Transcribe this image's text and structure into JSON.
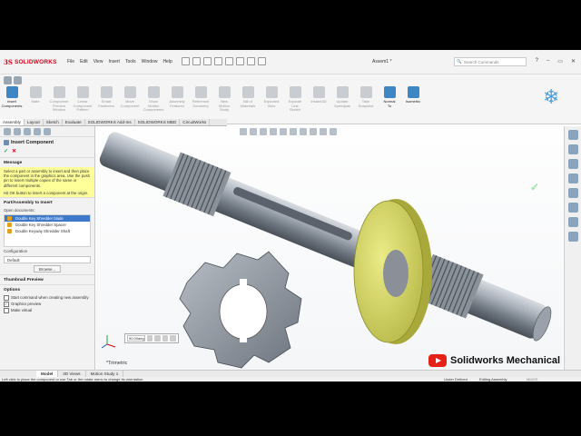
{
  "app": {
    "brand": "SOLIDWORKS",
    "document": "Assem1 *"
  },
  "menu": [
    "File",
    "Edit",
    "View",
    "Insert",
    "Tools",
    "Window",
    "Help"
  ],
  "search": {
    "placeholder": "Search Commands"
  },
  "ribbon": {
    "tools": [
      {
        "label": "Insert\nComponents",
        "active": true,
        "icon": "insert-components-icon"
      },
      {
        "label": "Mate",
        "active": false,
        "icon": "mate-icon"
      },
      {
        "label": "Component\nPreview\nWindow",
        "active": false,
        "icon": "component-preview-icon"
      },
      {
        "label": "Linear\nComponent\nPattern",
        "active": false,
        "icon": "linear-pattern-icon"
      },
      {
        "label": "Smart\nFasteners",
        "active": false,
        "icon": "smart-fasteners-icon"
      },
      {
        "label": "Move\nComponent",
        "active": false,
        "icon": "move-component-icon"
      },
      {
        "label": "Show\nHidden\nComponents",
        "active": false,
        "icon": "show-hidden-icon"
      },
      {
        "label": "Assembly\nFeatures",
        "active": false,
        "icon": "assembly-features-icon"
      },
      {
        "label": "Reference\nGeometry",
        "active": false,
        "icon": "reference-geometry-icon"
      },
      {
        "label": "New\nMotion\nStudy",
        "active": false,
        "icon": "motion-study-icon"
      },
      {
        "label": "Bill of\nMaterials",
        "active": false,
        "icon": "bom-icon"
      },
      {
        "label": "Exploded\nView",
        "active": false,
        "icon": "exploded-view-icon"
      },
      {
        "label": "Explode\nLine\nSketch",
        "active": false,
        "icon": "explode-line-icon"
      },
      {
        "label": "Instant3D",
        "active": false,
        "icon": "instant3d-icon"
      },
      {
        "label": "Update\nSpeedpak",
        "active": false,
        "icon": "speedpak-icon"
      },
      {
        "label": "Take\nSnapshot",
        "active": false,
        "icon": "snapshot-icon"
      },
      {
        "label": "Normal\nTo",
        "active": true,
        "icon": "normal-to-icon"
      },
      {
        "label": "Isometric",
        "active": true,
        "icon": "isometric-icon"
      }
    ]
  },
  "tabs": [
    "Assembly",
    "Layout",
    "Sketch",
    "Evaluate",
    "SOLIDWORKS Add-Ins",
    "SOLIDWORKS MBD",
    "CircuitWorks"
  ],
  "panel": {
    "title": "Insert Component",
    "message_header": "Message",
    "message": "Select a part or assembly to insert and then place the component in the graphics area. Use the push pin to insert multiple copies of the same or different components.",
    "message2": "Hit OK button to insert a component at the origin.",
    "part_header": "Part/Assembly to Insert",
    "open_docs_label": "Open documents:",
    "documents": [
      "Double Key Shredder blade",
      "Double Key Shredder Spacer",
      "Double Keyway Shredder Shaft"
    ],
    "config_label": "Configuration",
    "config_value": "Default",
    "browse": "Browse...",
    "thumb_header": "Thumbnail Preview",
    "options_header": "Options",
    "options": [
      {
        "label": "Start command when creating new assembly",
        "checked": false
      },
      {
        "label": "Graphics preview",
        "checked": true
      },
      {
        "label": "Make virtual",
        "checked": false
      }
    ]
  },
  "viewport": {
    "rotation_value": "90.00deg",
    "view_label": "*Trimetric"
  },
  "bottom_tabs": [
    "Model",
    "3D Views",
    "Motion Study 1"
  ],
  "status": {
    "hint": "Left click to place the component or use Tab or the rotate menu to change its orientation.",
    "defined": "Under Defined",
    "mode": "Editing Assembly",
    "units": "MMGS"
  },
  "watermark": "Solidworks Mechanical"
}
